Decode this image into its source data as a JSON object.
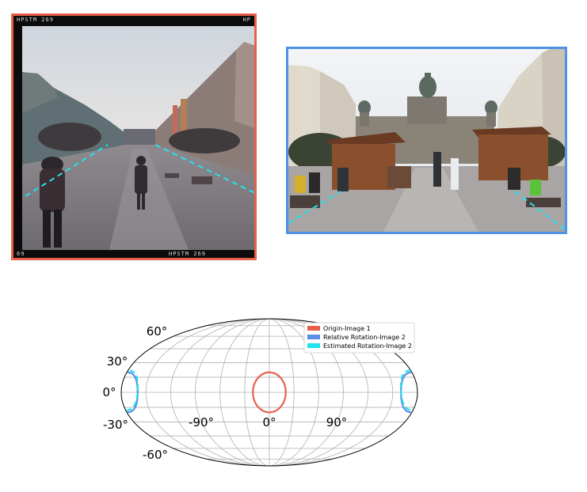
{
  "image1": {
    "film_text_top_left": "HPSTM 269",
    "film_text_top_right": "HP",
    "film_text_bottom_left": "69",
    "film_text_bottom_center": "HPSTM 269",
    "border_color": "#e8604c"
  },
  "image2": {
    "border_color": "#4f93e6"
  },
  "chart_data": {
    "type": "mollweide",
    "projection": "Mollweide",
    "grid": true,
    "x_tick_labels": [
      "-90°",
      "0°",
      "90°"
    ],
    "y_tick_labels": [
      "60°",
      "30°",
      "0°",
      "-30°",
      "-60°"
    ],
    "legend_position": "top-right",
    "legend": [
      {
        "label": "Origin-Image 1",
        "color": "#e8604c",
        "style": "solid"
      },
      {
        "label": "Relative Rotation-Image 2",
        "color": "#5b8ee6",
        "style": "solid"
      },
      {
        "label": "Estimated Rotation-Image 2",
        "color": "#1ee3ee",
        "style": "dashed"
      }
    ],
    "series": [
      {
        "name": "Origin-Image 1",
        "center_lon": 0,
        "center_lat": 0,
        "radius_deg": 20
      },
      {
        "name": "Relative Rotation-Image 2",
        "center_lon": 180,
        "center_lat": 0,
        "radius_deg": 20
      },
      {
        "name": "Estimated Rotation-Image 2",
        "center_lon": 180,
        "center_lat": 2,
        "radius_deg": 20
      }
    ]
  }
}
